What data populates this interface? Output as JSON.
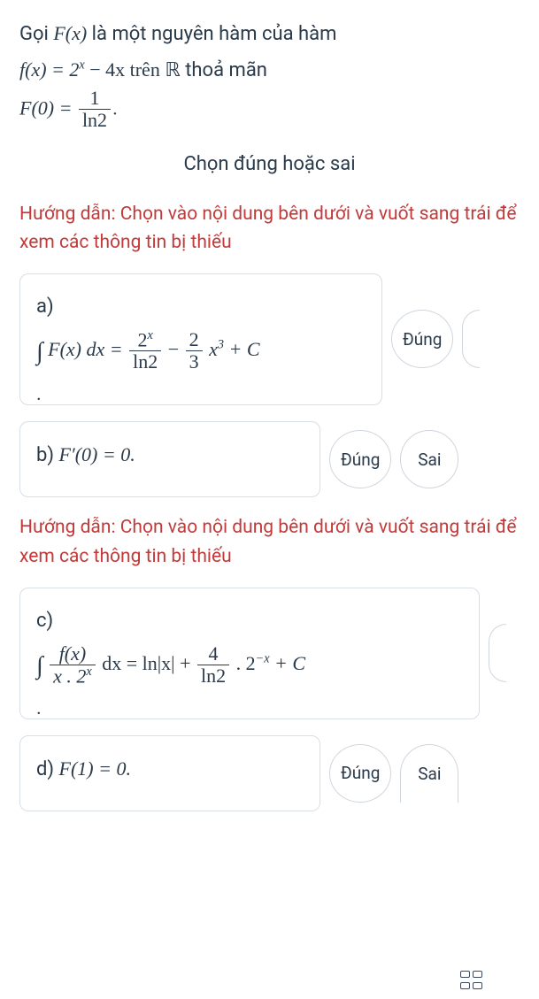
{
  "problem": {
    "line1_pre": "Gọi ",
    "line1_F": "F(x)",
    "line1_mid": " là một nguyên hàm của hàm",
    "line2_f": "f(x) = 2",
    "line2_fx_sup": "x",
    "line2_rest": " − 4x trên ",
    "line2_R": "ℝ",
    "line2_end": " thoả mãn",
    "line3_lhs": "F(0) = ",
    "line3_num": "1",
    "line3_den": "ln2",
    "line3_end": "."
  },
  "instruction": "Chọn đúng hoặc sai",
  "hint": "Hướng dẫn: Chọn vào nội dung bên dưới và vuốt sang trái để xem các thông tin bị thiếu",
  "items": {
    "a": {
      "label": "a)",
      "lhs_int": "∫",
      "lhs": "F(x) dx = ",
      "f1_num": "2",
      "f1_num_sup": "x",
      "f1_den": "ln2",
      "mid": " − ",
      "f2_num": "2",
      "f2_den": "3",
      "rhs": "x",
      "rhs_sup": "3",
      "tail": " + C",
      "period": "."
    },
    "b": {
      "label": "b) ",
      "expr": "F′(0) = 0."
    },
    "c": {
      "label": "c)",
      "int": "∫",
      "f1_num": "f(x)",
      "f1_den_pre": "x . 2",
      "f1_den_sup": "x",
      "mid1": " dx = ln|x| + ",
      "f2_num": "4",
      "f2_den": "ln2",
      "mid2": " . 2",
      "exp2": "−x",
      "tail": " + C",
      "period": "."
    },
    "d": {
      "label": "d) ",
      "expr": "F(1) = 0."
    }
  },
  "buttons": {
    "dung": "Đúng",
    "sai": "Sai"
  }
}
